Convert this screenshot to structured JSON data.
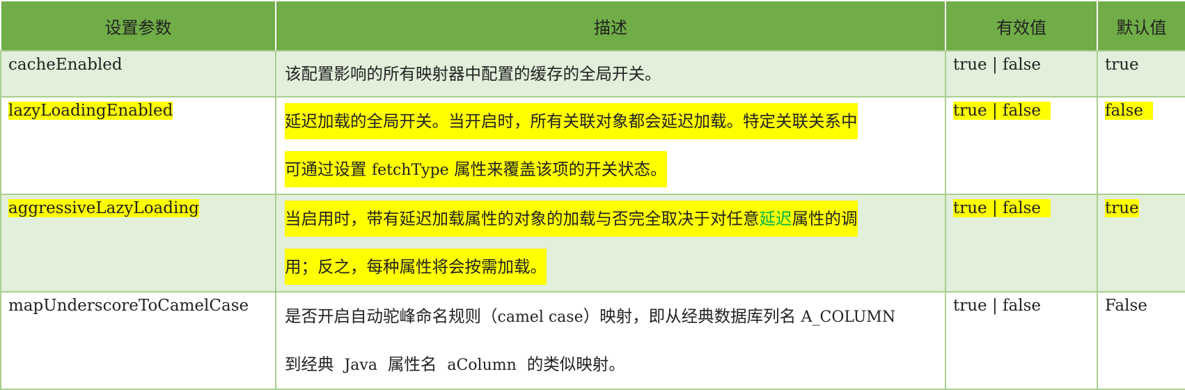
{
  "header": {
    "col1": "设置参数",
    "col2": "描述",
    "col3": "有效值",
    "col4": "默认值"
  },
  "rows": [
    {
      "param": "cacheEnabled",
      "desc_line1": "该配置影响的所有映射器中配置的缓存的全局开关。",
      "valid": "true | false",
      "default": "true"
    },
    {
      "param": "lazyLoadingEnabled",
      "desc_line1": "延迟加载的全局开关。当开启时，所有关联对象都会延迟加载。特定关联关系中",
      "desc_line2_a": "可通过设置",
      "desc_line2_code": "fetchType",
      "desc_line2_b": "属性来覆盖该项的开关状态。",
      "valid": "true | false",
      "default": "false"
    },
    {
      "param": "aggressiveLazyLoading",
      "desc_line1_a": "当启用时，带有延迟加载属性的对象的加载与否完全取决于对任意",
      "desc_line1_link": "延迟",
      "desc_line1_b": "属性的调",
      "desc_line2": "用；反之，每种属性将会按需加载。",
      "valid": "true | false",
      "default": "true"
    },
    {
      "param": "mapUnderscoreToCamelCase",
      "desc_line1_a": "是否开启自动驼峰命名规则（",
      "desc_line1_code": "camel case",
      "desc_line1_b": "）映射，即从经典数据库列名",
      "desc_line1_code2": "A_COLUMN",
      "desc_line2_a": "到经典",
      "desc_line2_code": "Java",
      "desc_line2_b": "属性名",
      "desc_line2_code2": "aColumn",
      "desc_line2_c": "的类似映射。",
      "valid": "true | false",
      "default": "False"
    }
  ],
  "colors": {
    "header_bg": "#70ad47",
    "alt_row_bg": "#e2efda",
    "border": "#a8d08d",
    "highlight": "#ffff00",
    "link_green": "#00b050"
  }
}
